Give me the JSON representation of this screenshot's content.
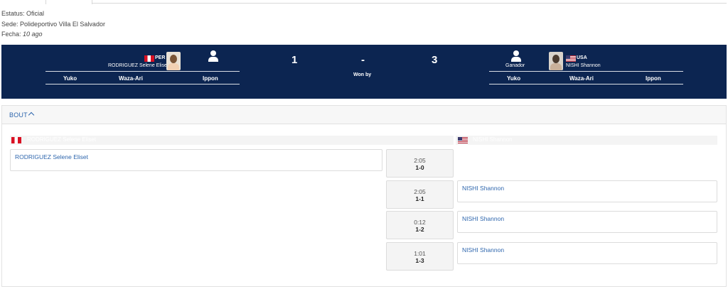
{
  "meta": {
    "status_label": "Estatus:",
    "status_value": "Oficial",
    "venue_label": "Sede:",
    "venue_value": "Polideportivo Villa El Salvador",
    "date_label": "Fecha:",
    "date_value": "10 ago"
  },
  "match": {
    "left": {
      "country": "PER",
      "name": "RODRIGUEZ Selene Eliset",
      "score": "1"
    },
    "right": {
      "country": "USA",
      "name": "NISHI Shannon",
      "score": "3",
      "winner_label": "Ganador"
    },
    "separator": "-",
    "won_by": "Won by",
    "score_headers": {
      "yuko": "Yuko",
      "waza_ari": "Waza-Ari",
      "ippon": "Ippon"
    }
  },
  "bout": {
    "title": "BOUT",
    "left_bar_text": "RODRIGUEZ Selene Eliset",
    "right_bar_text": "NISHI Shannon",
    "left_action": "RODRIGUEZ Selene Eliset",
    "rows": [
      {
        "time": "2:05",
        "score": "1-0",
        "side": "left",
        "name": "RODRIGUEZ Selene Eliset"
      },
      {
        "time": "2:05",
        "score": "1-1",
        "side": "right",
        "name": "NISHI Shannon"
      },
      {
        "time": "0:12",
        "score": "1-2",
        "side": "right",
        "name": "NISHI Shannon"
      },
      {
        "time": "1:01",
        "score": "1-3",
        "side": "right",
        "name": "NISHI Shannon"
      }
    ]
  },
  "colors": {
    "banner": "#0c2551",
    "link": "#2e66ad"
  },
  "icons": {
    "collapse": "chevron-up-icon",
    "athlete": "user-icon"
  }
}
